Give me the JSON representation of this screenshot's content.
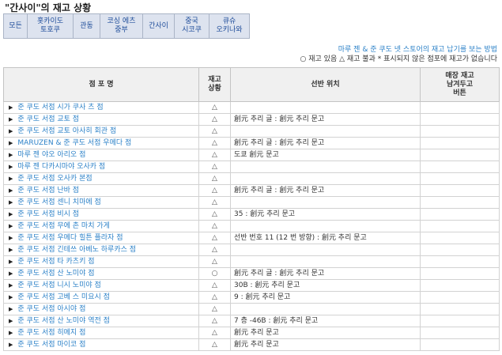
{
  "page_title": "\"간사이\"의 재고 상황",
  "regions": [
    {
      "label": "모든",
      "w": 30
    },
    {
      "label": "홋카이도\n토호쿠",
      "w": 58
    },
    {
      "label": "관동",
      "w": 34
    },
    {
      "label": "코싱 에츠\n중부",
      "w": 54
    },
    {
      "label": "간사이",
      "w": 40
    },
    {
      "label": "중국\n시코쿠",
      "w": 44
    },
    {
      "label": "큐슈\n오키나와",
      "w": 50
    }
  ],
  "help_link": "마루 젠 & 준 쿠도 넷 스토어의 재고 납기를 보는 방법",
  "legend": "○ 재고 있음 △ 재고 불과 * 표시되지 않은 점포에 재고가 없습니다",
  "table": {
    "headers": {
      "store": "점 포 명",
      "status": "재고\n상황",
      "shelf": "선반 위치",
      "note": "매장 재고\n남겨두고\n버튼"
    },
    "rows": [
      {
        "store": "준 쿠도 서점 시가 쿠사 츠 점",
        "status": "△",
        "shelf": ""
      },
      {
        "store": "준 쿠도 서점 교토 점",
        "status": "△",
        "shelf": "創元 추리 글 : 創元 추리 문고"
      },
      {
        "store": "준 쿠도 서점 교토 아사히 회관 점",
        "status": "△",
        "shelf": ""
      },
      {
        "store": "MARUZEN & 준 쿠도 서점 우메다 점",
        "status": "△",
        "shelf": "創元 추리 글 : 創元 추리 문고"
      },
      {
        "store": "마루 젠 야오 아리오 점",
        "status": "△",
        "shelf": "도쿄 創元 문고"
      },
      {
        "store": "마루 젠 다카시마야 오사카 점",
        "status": "△",
        "shelf": ""
      },
      {
        "store": "준 쿠도 서점 오사카 본점",
        "status": "△",
        "shelf": ""
      },
      {
        "store": "준 쿠도 서점 난바 점",
        "status": "△",
        "shelf": "創元 추리 글 : 創元 추리 문고"
      },
      {
        "store": "준 쿠도 서점 센니 치마에 점",
        "status": "△",
        "shelf": ""
      },
      {
        "store": "준 쿠도 서점 비시 점",
        "status": "△",
        "shelf": "35 : 創元 추리 문고"
      },
      {
        "store": "준 쿠도 서점 무에 촌 마치 가게",
        "status": "△",
        "shelf": ""
      },
      {
        "store": "준 쿠도 서점 우메다 힐튼 플라자 점",
        "status": "△",
        "shelf": "선반 번호 11 (12 번 방향) : 創元 추리 문고"
      },
      {
        "store": "준 쿠도 서점 긴테쓰 아베노 하루카스 점",
        "status": "△",
        "shelf": ""
      },
      {
        "store": "준 쿠도 서점 타 카츠키 점",
        "status": "△",
        "shelf": ""
      },
      {
        "store": "준 쿠도 서점 산 노미야 점",
        "status": "○",
        "shelf": "創元 추리 글 : 創元 추리 문고"
      },
      {
        "store": "준 쿠도 서점 니시 노미야 점",
        "status": "△",
        "shelf": "30B : 創元 추리 문고"
      },
      {
        "store": "준 쿠도 서점 고베 스 미요시 점",
        "status": "△",
        "shelf": "9 : 創元 추리 문고"
      },
      {
        "store": "준 쿠도 서점 아시야 점",
        "status": "△",
        "shelf": ""
      },
      {
        "store": "준 쿠도 서점 산 노미야 역전 점",
        "status": "△",
        "shelf": "7 층 -46B : 創元 추리 문고"
      },
      {
        "store": "준 쿠도 서점 히메지 점",
        "status": "△",
        "shelf": "創元 추리 문고"
      },
      {
        "store": "준 쿠도 서점 마이코 점",
        "status": "△",
        "shelf": "創元 추리 문고"
      }
    ]
  }
}
